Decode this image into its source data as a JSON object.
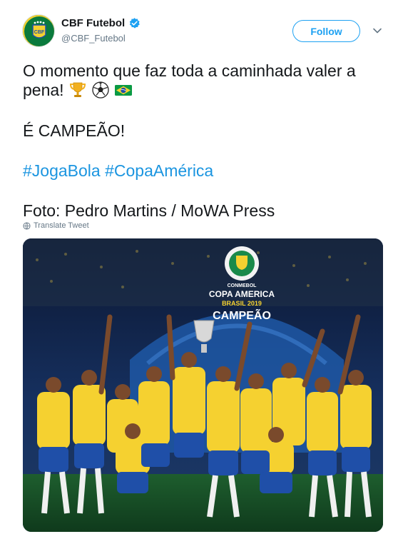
{
  "user": {
    "display_name": "CBF Futebol",
    "handle": "@CBF_Futebol",
    "follow_label": "Follow"
  },
  "tweet": {
    "line1": "O momento que faz toda a caminhada valer a",
    "line2": "pena!",
    "line3": "É CAMPEÃO!",
    "hashtag1": "#JogaBola",
    "hashtag2": "#CopaAmérica",
    "credit": "Foto: Pedro Martins / MoWA Press",
    "translate_label": "Translate Tweet"
  },
  "photo": {
    "banner_top": "CONMEBOL",
    "banner_main": "COPA AMERICA",
    "banner_sub": "BRASIL 2019",
    "banner_word": "CAMPEÃO"
  },
  "colors": {
    "link": "#1b95e0",
    "follow": "#1da1f2",
    "brazil_yellow": "#f5d130",
    "brazil_blue": "#1f4fa8",
    "brazil_green": "#0a7a3d"
  },
  "icons": [
    "verified-badge-icon",
    "chevron-down-icon",
    "trophy-emoji",
    "soccer-ball-emoji",
    "brazil-flag-emoji",
    "globe-icon"
  ]
}
